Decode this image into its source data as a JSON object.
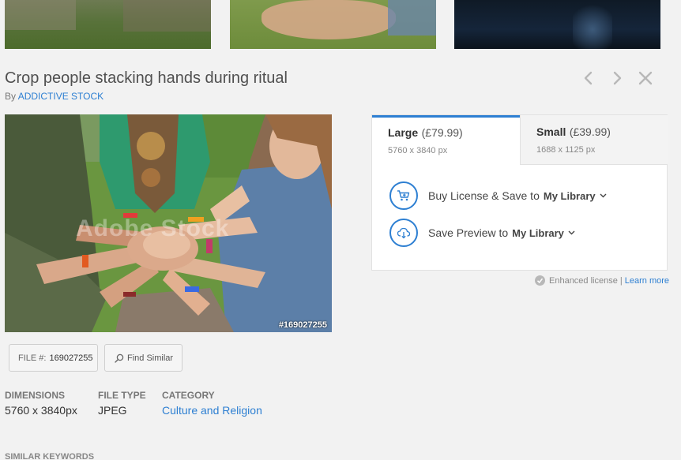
{
  "thumbnails": [
    "thumbnail-garden",
    "thumbnail-hands",
    "thumbnail-night-water"
  ],
  "asset": {
    "title": "Crop people stacking hands during ritual",
    "by_label": "By",
    "author": "ADDICTIVE STOCK",
    "watermark": "Adobe Stock",
    "image_id_overlay": "#169027255"
  },
  "nav": {
    "prev_icon": "chevron-left-icon",
    "next_icon": "chevron-right-icon",
    "close_icon": "close-icon"
  },
  "file_chip": {
    "label": "FILE #:",
    "value": "169027255"
  },
  "find_similar": {
    "label": "Find Similar",
    "icon": "search-icon"
  },
  "meta": {
    "dimensions_label": "DIMENSIONS",
    "dimensions_value": "5760 x 3840px",
    "filetype_label": "FILE TYPE",
    "filetype_value": "JPEG",
    "category_label": "CATEGORY",
    "category_value": "Culture and Religion"
  },
  "similar_keywords_label": "SIMILAR KEYWORDS",
  "license": {
    "tabs": [
      {
        "name": "Large",
        "price": "(£79.99)",
        "dims": "5760 x 3840 px",
        "selected": true
      },
      {
        "name": "Small",
        "price": "(£39.99)",
        "dims": "1688 x 1125 px",
        "selected": false
      }
    ],
    "buy": {
      "text": "Buy License & Save to",
      "library": "My Library",
      "icon": "cart-icon"
    },
    "save": {
      "text": "Save Preview to",
      "library": "My Library",
      "icon": "cloud-download-icon"
    }
  },
  "enhanced": {
    "text": "Enhanced license |",
    "link": "Learn more"
  },
  "colors": {
    "accent": "#2d7fd2",
    "background": "#f2f2f2"
  }
}
